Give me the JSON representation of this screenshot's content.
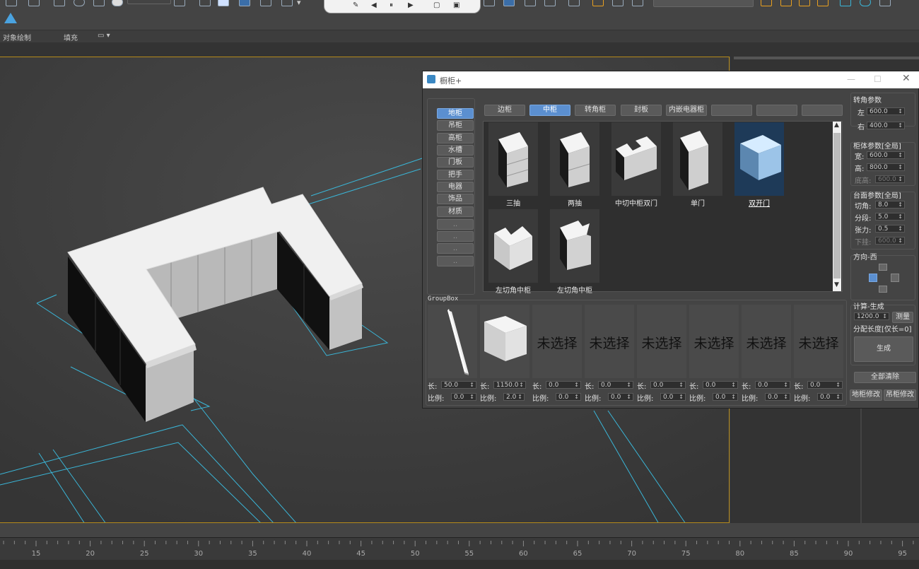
{
  "ribbon": {
    "object_paint": "对象绘制",
    "fill": "填充"
  },
  "dialog": {
    "title": "橱柜+",
    "nav": [
      "地柜",
      "吊柜",
      "高柜",
      "水槽",
      "门板",
      "把手",
      "电器",
      "饰品",
      "材质",
      "..",
      "..",
      "..",
      ".."
    ],
    "tabs": [
      "边柜",
      "中柜",
      "转角柜",
      "封板",
      "内嵌电器柜",
      "",
      "",
      ""
    ],
    "active_tab": "中柜",
    "active_nav": "地柜",
    "thumbs": [
      "三抽",
      "两抽",
      "中切中柜双门",
      "单门",
      "双开门",
      "左切角中柜",
      "左切角中柜"
    ],
    "selected_thumb": "双开门",
    "groupbox_label": "GroupBox",
    "slots": [
      {
        "len": "50.0",
        "ratio": "0.0"
      },
      {
        "len": "1150.0",
        "ratio": "2.0"
      },
      {
        "placeholder": "未选择",
        "len": "0.0",
        "ratio": "0.0"
      },
      {
        "placeholder": "未选择",
        "len": "0.0",
        "ratio": "0.0"
      },
      {
        "placeholder": "未选择",
        "len": "0.0",
        "ratio": "0.0"
      },
      {
        "placeholder": "未选择",
        "len": "0.0",
        "ratio": "0.0"
      },
      {
        "placeholder": "未选择",
        "len": "0.0",
        "ratio": "0.0"
      },
      {
        "placeholder": "未选择",
        "len": "0.0",
        "ratio": "0.0"
      }
    ],
    "len_label": "长:",
    "ratio_label": "比例:",
    "corner": {
      "title": "转角参数",
      "left_label": "左",
      "left": "600.0",
      "right_label": "右",
      "right": "400.0"
    },
    "body": {
      "title": "柜体参数[全局]",
      "width_label": "宽:",
      "width": "600.0",
      "height_label": "高:",
      "height": "800.0",
      "base_label": "底高:",
      "base": "600.0"
    },
    "top": {
      "title": "台面参数[全局]",
      "chamfer_label": "切角:",
      "chamfer": "8.0",
      "seg_label": "分段:",
      "seg": "5.0",
      "tension_label": "张力:",
      "tension": "0.5",
      "hang_label": "下挂:",
      "hang": "600.0"
    },
    "direction": {
      "title": "方向-西"
    },
    "calc": {
      "title": "计算-生成",
      "value": "1200.0",
      "measure": "测量",
      "hint": "分配长度[仅长=0]",
      "generate": "生成"
    },
    "clear_all": "全部清除",
    "floor_modify": "地柜修改",
    "wall_modify": "吊柜修改"
  },
  "timeline": {
    "ticks": [
      "15",
      "20",
      "25",
      "30",
      "35",
      "40",
      "45",
      "50",
      "55",
      "60",
      "65",
      "70",
      "75",
      "80",
      "85",
      "90",
      "95"
    ]
  },
  "colors": {
    "accent": "#5b8fd0",
    "viewport_border": "#b58a1a",
    "grid_line": "#3ab6d8"
  }
}
